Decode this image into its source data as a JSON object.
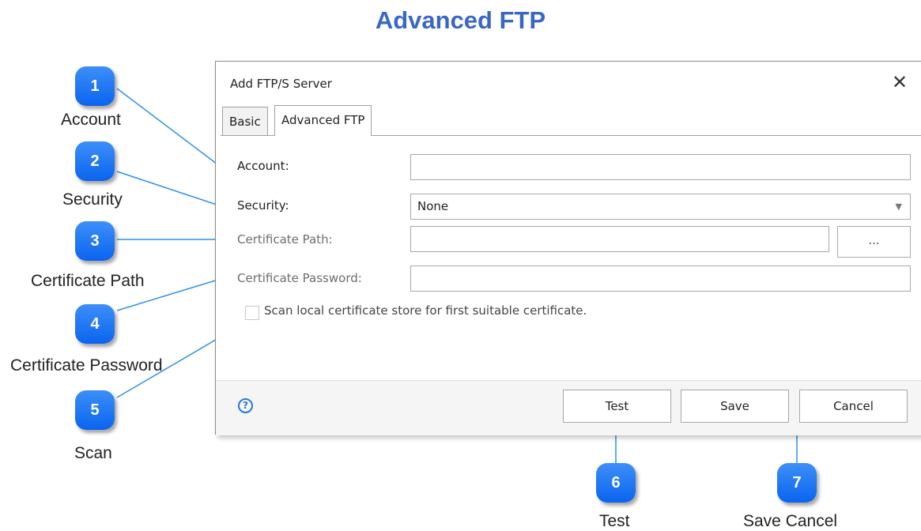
{
  "page_title": "Advanced FTP",
  "dialog": {
    "title": "Add FTP/S Server",
    "close_glyph": "✕",
    "tabs": [
      {
        "label": "Basic",
        "active": false
      },
      {
        "label": "Advanced FTP",
        "active": true
      }
    ],
    "fields": {
      "account": {
        "label": "Account:",
        "value": ""
      },
      "security": {
        "label": "Security:",
        "value": "None"
      },
      "certificate_path": {
        "label": "Certificate Path:",
        "value": "",
        "browse_label": "..."
      },
      "certificate_password": {
        "label": "Certificate Password:",
        "value": ""
      }
    },
    "scan_checkbox": {
      "label": "Scan local certificate store for first suitable certificate.",
      "checked": false
    },
    "footer": {
      "help_glyph": "?",
      "test_label": "Test",
      "save_label": "Save",
      "cancel_label": "Cancel"
    }
  },
  "callouts": [
    {
      "number": "1",
      "label": "Account"
    },
    {
      "number": "2",
      "label": "Security"
    },
    {
      "number": "3",
      "label": "Certificate Path"
    },
    {
      "number": "4",
      "label": "Certificate Password"
    },
    {
      "number": "5",
      "label": "Scan"
    },
    {
      "number": "6",
      "label": "Test"
    },
    {
      "number": "7",
      "label": "Save Cancel"
    }
  ],
  "colors": {
    "title": "#3a67c6",
    "badge": "#1a73f0",
    "connector": "#2f8fe6"
  }
}
